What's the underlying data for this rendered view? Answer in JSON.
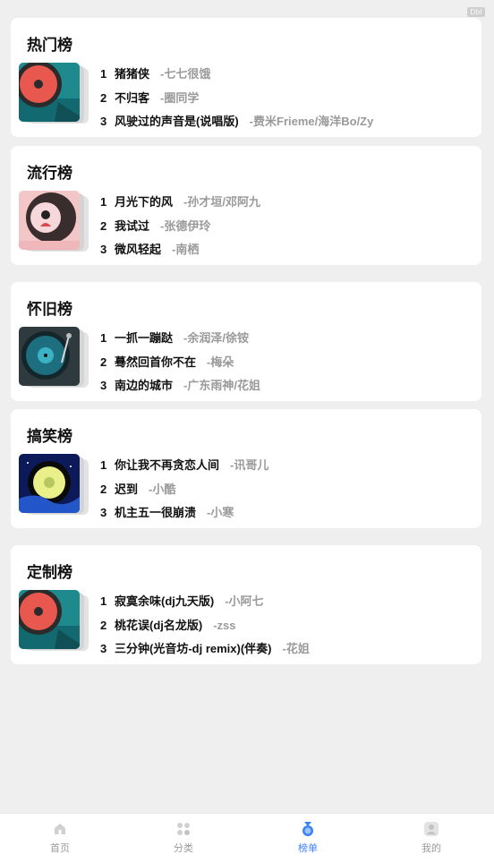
{
  "debug_badge": "Dbl",
  "charts": [
    {
      "title": "热门榜",
      "songs": [
        {
          "rank": "1",
          "name": "猪猪侠",
          "artist": "-七七很饿"
        },
        {
          "rank": "2",
          "name": "不归客",
          "artist": "-圈同学"
        },
        {
          "rank": "3",
          "name": "风驶过的声音是(说唱版)",
          "artist": "-费米Frieme/海洋Bo/Zy"
        }
      ]
    },
    {
      "title": "流行榜",
      "songs": [
        {
          "rank": "1",
          "name": "月光下的风",
          "artist": "-孙才垣/邓阿九"
        },
        {
          "rank": "2",
          "name": "我试过",
          "artist": "-张德伊玲"
        },
        {
          "rank": "3",
          "name": "微风轻起",
          "artist": "-南栖"
        }
      ]
    },
    {
      "title": "怀旧榜",
      "songs": [
        {
          "rank": "1",
          "name": "一抓一蹦跶",
          "artist": "-余润泽/徐铵"
        },
        {
          "rank": "2",
          "name": "蓦然回首你不在",
          "artist": "-梅朵"
        },
        {
          "rank": "3",
          "name": "南边的城市",
          "artist": "-广东雨神/花姐"
        }
      ]
    },
    {
      "title": "搞笑榜",
      "songs": [
        {
          "rank": "1",
          "name": "你让我不再贪恋人间",
          "artist": "-讯哥儿"
        },
        {
          "rank": "2",
          "name": "迟到",
          "artist": "-小酷"
        },
        {
          "rank": "3",
          "name": "机主五一很崩溃",
          "artist": "-小寒"
        }
      ]
    },
    {
      "title": "定制榜",
      "songs": [
        {
          "rank": "1",
          "name": "寂寞余味(dj九天版)",
          "artist": "-小阿七"
        },
        {
          "rank": "2",
          "name": "桃花误(dj名龙版)",
          "artist": "-zss"
        },
        {
          "rank": "3",
          "name": "三分钟(光音坊-dj remix)(伴奏)",
          "artist": "-花姐"
        }
      ]
    }
  ],
  "tabbar": {
    "items": [
      {
        "label": "首页",
        "icon": "home-icon"
      },
      {
        "label": "分类",
        "icon": "category-icon"
      },
      {
        "label": "榜单",
        "icon": "medal-icon",
        "active": true
      },
      {
        "label": "我的",
        "icon": "user-icon"
      }
    ]
  },
  "colors": {
    "accent": "#3b82f6",
    "muted": "#9a9a9a",
    "background": "#efefef"
  }
}
